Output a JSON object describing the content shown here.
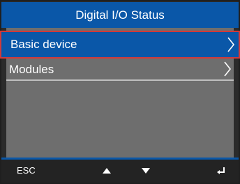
{
  "header": {
    "title": "Digital I/O Status"
  },
  "menu": {
    "items": [
      {
        "label": "Basic device",
        "selected": true
      },
      {
        "label": "Modules",
        "selected": false
      }
    ]
  },
  "footer": {
    "esc_label": "ESC",
    "icons": [
      "up-arrow-icon",
      "down-arrow-icon",
      "enter-icon"
    ]
  },
  "colors": {
    "accent": "#0a57a8",
    "selection_border": "#d23a3a",
    "panel": "#6e6e6e",
    "footer": "#232323"
  }
}
